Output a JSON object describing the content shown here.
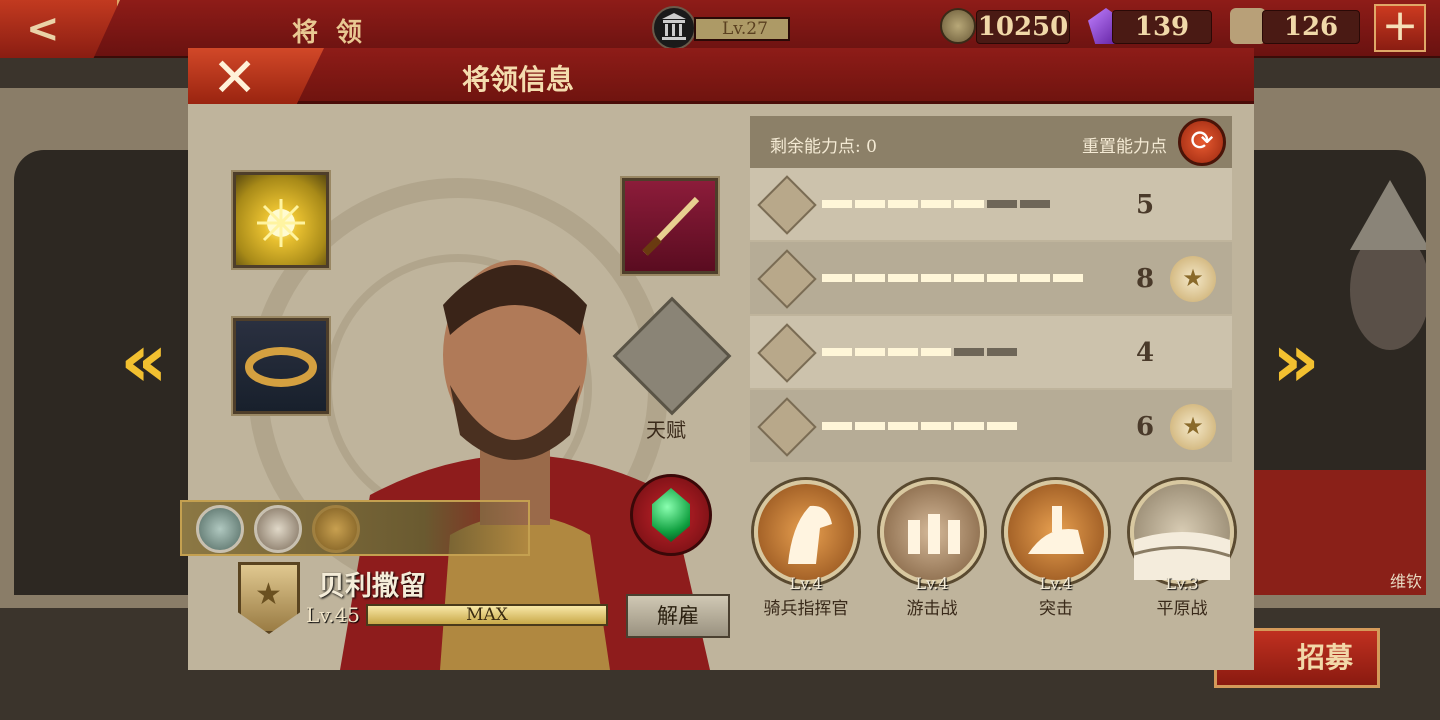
{
  "header": {
    "title": "将领",
    "level_label": "Lv.27",
    "resources": [
      {
        "icon": "coin-icon",
        "value": "10250"
      },
      {
        "icon": "gem-icon",
        "value": "139"
      },
      {
        "icon": "helmet-icon",
        "value": "126"
      }
    ],
    "add_label": "+",
    "back_label": "<"
  },
  "modal": {
    "title": "将领信息",
    "close_label": "✕"
  },
  "equipment": {
    "talent_label": "天赋"
  },
  "general": {
    "name": "贝利撒留",
    "level": "Lv.45",
    "xp_label": "MAX",
    "dismiss_label": "解雇"
  },
  "stats": {
    "points_label": "剩余能力点: 0",
    "reset_label": "重置能力点",
    "rows": [
      {
        "icon": "sword-icon",
        "value": "5",
        "filled": 5,
        "total": 7,
        "badge": false
      },
      {
        "icon": "horse-icon",
        "value": "8",
        "filled": 8,
        "total": 8,
        "badge": true
      },
      {
        "icon": "bow-icon",
        "value": "4",
        "filled": 4,
        "total": 6,
        "badge": false
      },
      {
        "icon": "anchor-icon",
        "value": "6",
        "filled": 6,
        "total": 6,
        "badge": true
      }
    ]
  },
  "skills": [
    {
      "level": "Lv.4",
      "name": "骑兵指挥官",
      "icon": "horse-head-icon"
    },
    {
      "level": "Lv.4",
      "name": "游击战",
      "icon": "skirmish-riders-icon"
    },
    {
      "level": "Lv.4",
      "name": "突击",
      "icon": "charge-rider-icon"
    },
    {
      "level": "Lv.3",
      "name": "平原战",
      "icon": "plains-icon"
    }
  ],
  "background": {
    "recruit_label": "招募",
    "right_name": "维钦"
  },
  "colors": {
    "accent_red": "#8e1c18",
    "gold": "#e8c892",
    "panel": "#bfb49c"
  }
}
